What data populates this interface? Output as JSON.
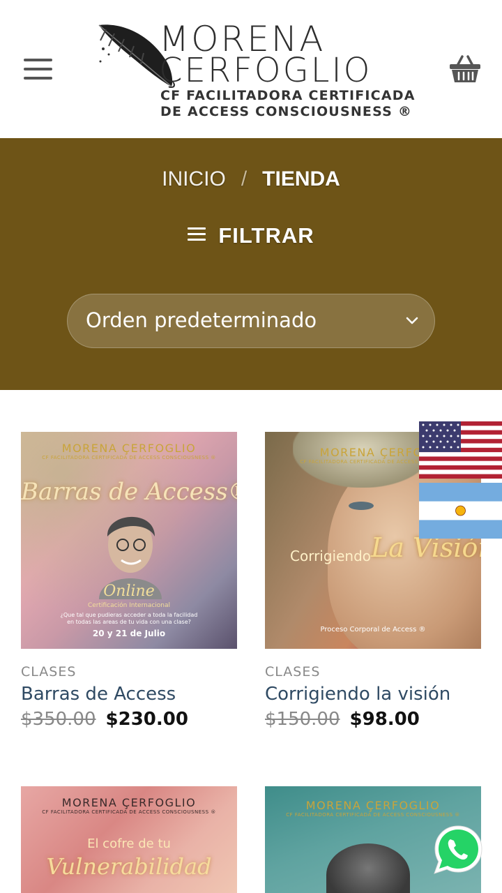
{
  "header": {
    "logo_name_line1": "MORENA",
    "logo_name_line2": "ÇERFOGLIO",
    "logo_sub_line1": "CF FACILITADORA CERTIFICADA",
    "logo_sub_line2": "DE ACCESS CONSCIOUSNESS ®",
    "menu_icon": "hamburger-icon",
    "cart_icon": "basket-icon"
  },
  "breadcrumb": {
    "home": "INICIO",
    "separator": "/",
    "current": "TIENDA"
  },
  "filter": {
    "label": "FILTRAR",
    "icon": "filter-lines-icon"
  },
  "sort": {
    "value": "Orden predeterminado"
  },
  "colors": {
    "band": "#6e5417",
    "title": "#2f4a63",
    "gold": "#c9a43a"
  },
  "products": [
    {
      "category": "CLASES",
      "title": "Barras de Access",
      "old_price": "$350.00",
      "new_price": "$230.00",
      "image": {
        "brand": "MORENA ÇERFOGLIO",
        "brand_sub": "CF FACILITADORA CERTIFICADA DE ACCESS CONSCIOUSNESS ®",
        "headline": "Barras de Access®",
        "tag": "Online",
        "tag_sub": "Certificación Internacional",
        "tagline_1": "¿Que tal que pudieras acceder a toda la facilidad",
        "tagline_2": "en todas las areas de tu vida con una clase?",
        "dates": "20 y 21 de Julio"
      }
    },
    {
      "category": "CLASES",
      "title": "Corrigiendo la visión",
      "old_price": "$150.00",
      "new_price": "$98.00",
      "image": {
        "brand": "MORENA ÇERFOGLIO",
        "brand_sub": "CF FACILITADORA CERTIFICADA DE ACCESS CONSCIOUSNESS ®",
        "headline_a": "Corrigiendo",
        "headline_b": "La Visión",
        "footer": "Proceso Corporal de Access ®"
      }
    },
    {
      "image": {
        "brand": "MORENA ÇERFOGLIO",
        "brand_sub": "CF FACILITADORA CERTIFICADA DE ACCESS CONSCIOUSNESS ®",
        "headline_a": "El cofre de tu",
        "headline_b": "Vulnerabilidad"
      }
    },
    {
      "image": {
        "brand": "MORENA ÇERFOGLIO",
        "brand_sub": "CF FACILITADORA CERTIFICADA DE ACCESS CONSCIOUSNESS ®"
      }
    }
  ],
  "floating": {
    "flag_1": "usa-flag-icon",
    "flag_2": "argentina-flag-icon",
    "chat": "whatsapp-icon"
  }
}
